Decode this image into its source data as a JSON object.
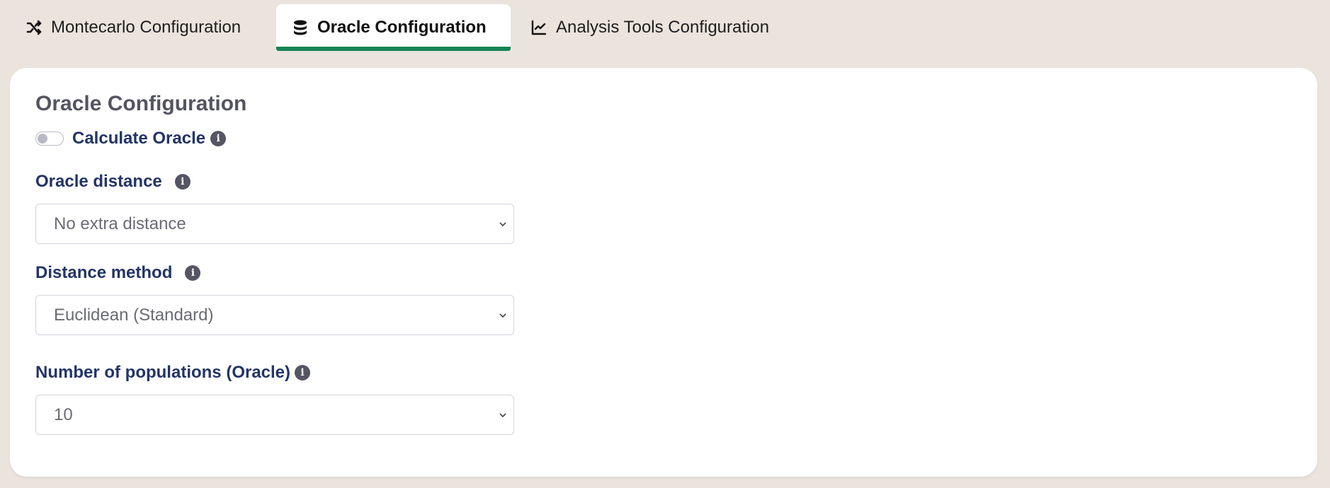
{
  "tabs": [
    {
      "label": "Montecarlo Configuration",
      "icon": "shuffle-icon",
      "active": false
    },
    {
      "label": "Oracle Configuration",
      "icon": "database-icon",
      "active": true
    },
    {
      "label": "Analysis Tools Configuration",
      "icon": "chart-line-icon",
      "active": false
    }
  ],
  "colors": {
    "accent": "#148452",
    "label": "#233466",
    "background": "#ebe4dd"
  },
  "card": {
    "title": "Oracle Configuration",
    "calculate_oracle": {
      "label": "Calculate Oracle",
      "enabled": false,
      "info_icon": "info-circle-icon"
    },
    "oracle_distance": {
      "label": "Oracle distance",
      "value": "No extra distance"
    },
    "distance_method": {
      "label": "Distance method",
      "value": "Euclidean (Standard)"
    },
    "num_populations": {
      "label": "Number of populations (Oracle)",
      "value": "10"
    }
  }
}
